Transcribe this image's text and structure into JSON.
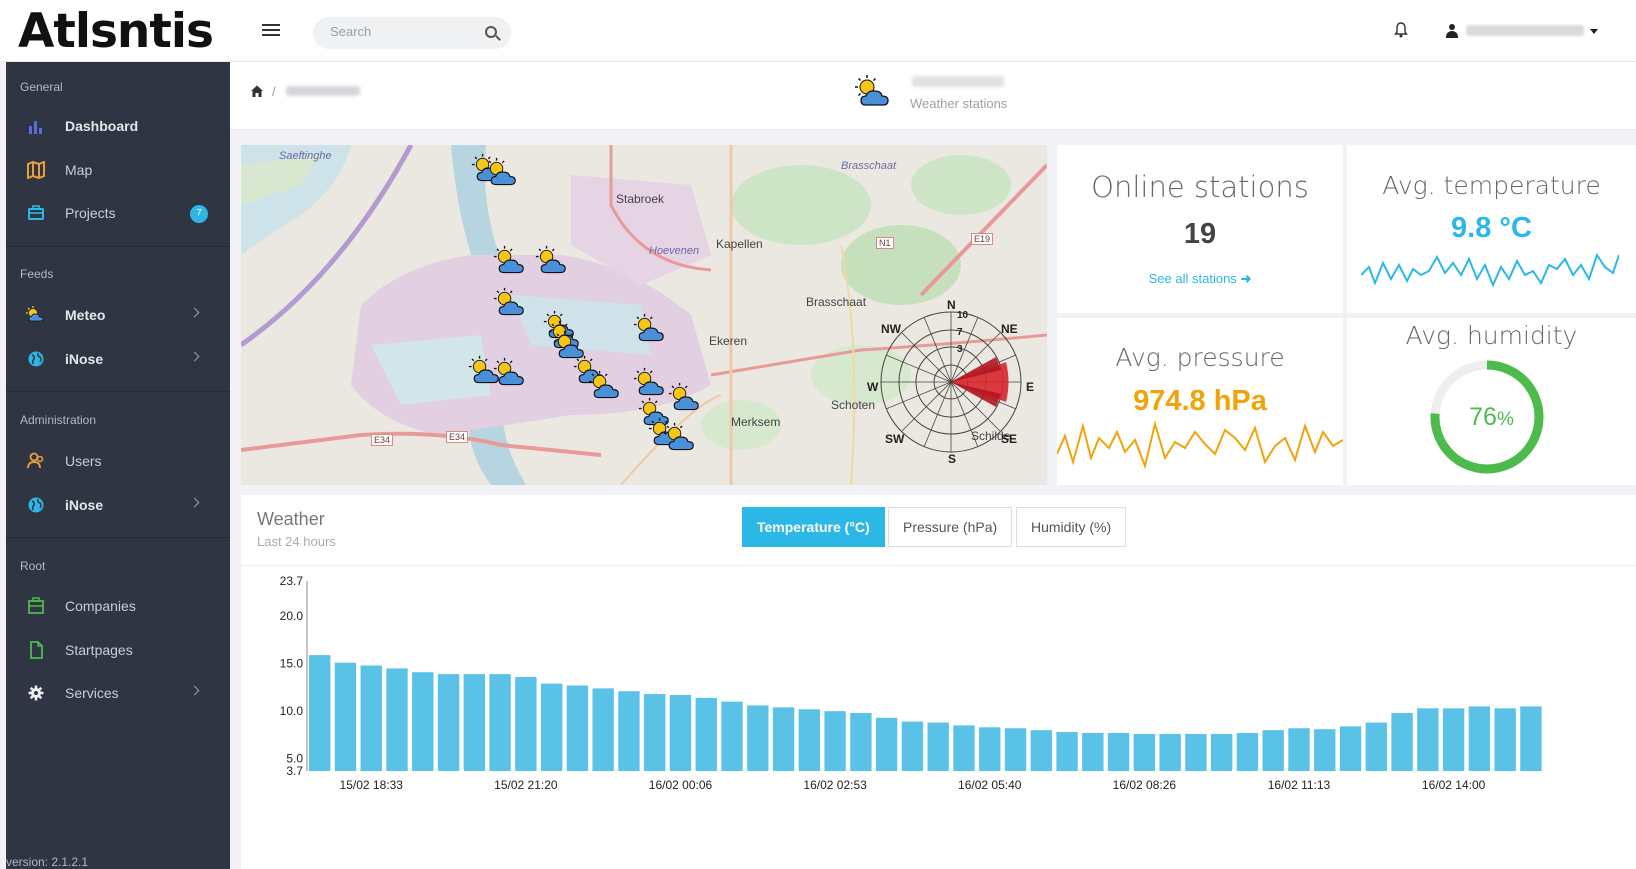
{
  "brand": {
    "logo_text": "Atlsntis"
  },
  "search": {
    "placeholder": "Search"
  },
  "sidebar": {
    "sections": [
      {
        "title": "General",
        "items": [
          {
            "label": "Dashboard",
            "icon": "bar-chart-icon"
          },
          {
            "label": "Map",
            "icon": "map-icon"
          },
          {
            "label": "Projects",
            "icon": "briefcase-icon",
            "badge": "7"
          }
        ]
      },
      {
        "title": "Feeds",
        "items": [
          {
            "label": "Meteo",
            "icon": "weather-icon"
          },
          {
            "label": "iNose",
            "icon": "globe-icon"
          }
        ]
      },
      {
        "title": "Administration",
        "items": [
          {
            "label": "Users",
            "icon": "users-icon"
          },
          {
            "label": "iNose",
            "icon": "globe-icon"
          }
        ]
      },
      {
        "title": "Root",
        "items": [
          {
            "label": "Companies",
            "icon": "building-icon"
          },
          {
            "label": "Startpages",
            "icon": "file-icon"
          },
          {
            "label": "Services",
            "icon": "gear-icon"
          }
        ]
      }
    ],
    "version": "version: 2.1.2.1"
  },
  "header": {
    "breadcrumb_sep": "/",
    "subtitle": "Weather stations"
  },
  "map": {
    "labels": [
      "Saeftinghe",
      "Stabroek",
      "Hoevenen",
      "Kapellen",
      "Brasschaat",
      "Ekeren",
      "Merksem",
      "Schoten",
      "Brasschaat",
      "Schilde"
    ],
    "road_labels": [
      "E34",
      "E34",
      "E19",
      "N1"
    ],
    "compass": [
      "N",
      "NE",
      "E",
      "SE",
      "S",
      "SW",
      "W",
      "NW"
    ],
    "rings": [
      "10",
      "7",
      "3"
    ]
  },
  "stats": {
    "online": {
      "title": "Online stations",
      "value": "19",
      "link": "See all stations"
    },
    "temperature": {
      "title": "Avg. temperature",
      "value": "9.8 °C"
    },
    "pressure": {
      "title": "Avg. pressure",
      "value": "974.8 hPa"
    },
    "humidity": {
      "title": "Avg. humidity",
      "value": "76",
      "unit": "%",
      "percent": 76
    }
  },
  "colors": {
    "accent": "#2bb8e6",
    "pressure": "#f0a30a",
    "humidity": "#4cbb4c",
    "bar": "#5bc2e7",
    "sidebar": "#2f3542"
  },
  "weather": {
    "title": "Weather",
    "subtitle": "Last 24 hours",
    "tabs": [
      "Temperature (°C)",
      "Pressure (hPa)",
      "Humidity (%)"
    ]
  },
  "chart_data": {
    "type": "bar",
    "ylim": [
      3.7,
      23.7
    ],
    "yticks": [
      "23.7",
      "20.0",
      "15.0",
      "10.0",
      "5.0",
      "3.7"
    ],
    "ytick_values": [
      23.7,
      20.0,
      15.0,
      10.0,
      5.0,
      3.7
    ],
    "xticks": [
      "15/02 18:33",
      "15/02 21:20",
      "16/02 00:06",
      "16/02 02:53",
      "16/02 05:40",
      "16/02 08:26",
      "16/02 11:13",
      "16/02 14:00"
    ],
    "values": [
      15.9,
      15.1,
      14.8,
      14.5,
      14.1,
      13.9,
      13.9,
      13.9,
      13.6,
      12.9,
      12.7,
      12.4,
      12.1,
      11.8,
      11.7,
      11.4,
      11.0,
      10.6,
      10.4,
      10.2,
      10.0,
      9.8,
      9.3,
      8.9,
      8.8,
      8.5,
      8.3,
      8.2,
      8.0,
      7.8,
      7.7,
      7.7,
      7.6,
      7.6,
      7.6,
      7.6,
      7.7,
      8.0,
      8.2,
      8.1,
      8.4,
      8.8,
      9.8,
      10.3,
      10.3,
      10.5,
      10.3,
      10.5
    ]
  }
}
